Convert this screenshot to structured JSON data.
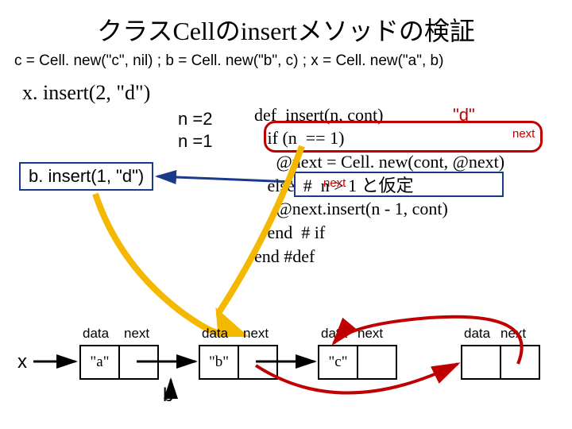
{
  "title": "クラスCellのinsertメソッドの検証",
  "setup": "c = Cell. new(\"c\", nil) ; b = Cell. new(\"b\", c) ; x = Cell. new(\"a\", b)",
  "call1": "x. insert(2, \"d\")",
  "n2": "n =2",
  "n1": "n =1",
  "call2": "b. insert(1, \"d\")",
  "code_l1": "def  insert(n, cont)",
  "code_l2": "   if (n  == 1)",
  "code_l3": "     @next = Cell. new(cont, @next)",
  "code_l4": "   else  #  n > 1 と仮定",
  "code_l5": "     @next.insert(n - 1, cont)",
  "code_l6": "   end  # if",
  "code_l7": "end #def",
  "dlabel": "\"d\"",
  "nextlabel": "next",
  "hdr_data": "data",
  "hdr_next": "next",
  "xvar": "x",
  "bvar": "b",
  "cell_a": "\"a\"",
  "cell_b": "\"b\"",
  "cell_c": "\"c\""
}
